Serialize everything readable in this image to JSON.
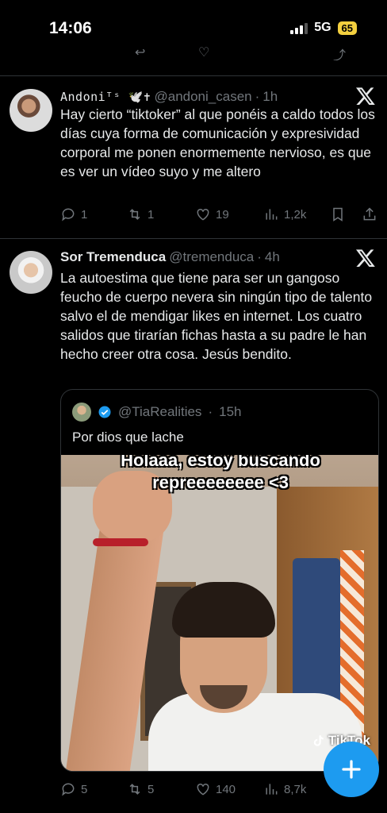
{
  "status_bar": {
    "time": "14:06",
    "network": "5G",
    "battery": "65"
  },
  "tweets": [
    {
      "name": "Andoniᵀˢ 🕊️✝",
      "handle": "@andoni_casen",
      "time": "1h",
      "text": "Hay cierto “tiktoker” al que ponéis a caldo todos los días cuya forma de comunicación y expresividad corporal me ponen enormemente nervioso, es que es ver un vídeo suyo y me altero",
      "replies": "1",
      "reposts": "1",
      "likes": "19",
      "views": "1,2k"
    },
    {
      "name": "Sor Tremenduca",
      "handle": "@tremenduca",
      "time": "4h",
      "text": "La autoestima que tiene para ser un gangoso feucho de cuerpo nevera sin ningún tipo de talento salvo el de mendigar likes en internet. Los cuatro salidos que tirarían fichas hasta a su padre le han hecho creer otra cosa. Jesús bendito.",
      "replies": "5",
      "reposts": "5",
      "likes": "140",
      "views": "8,7k",
      "quote": {
        "handle": "@TiaRealities",
        "time": "15h",
        "text": "Por dios que lache",
        "video_caption_line1": "Holaaa, estoy buscando",
        "video_caption_line2": "repreeeeeeee <3",
        "watermark": "TikTok"
      }
    }
  ],
  "colors": {
    "accent": "#1d9bf0",
    "muted": "#71767b",
    "divider": "#2f3336",
    "battery": "#f4d03f"
  },
  "icons": [
    "x-logo-icon",
    "reply-icon",
    "repost-icon",
    "like-icon",
    "views-icon",
    "bookmark-icon",
    "share-icon",
    "verified-badge-icon",
    "compose-plus-icon"
  ]
}
